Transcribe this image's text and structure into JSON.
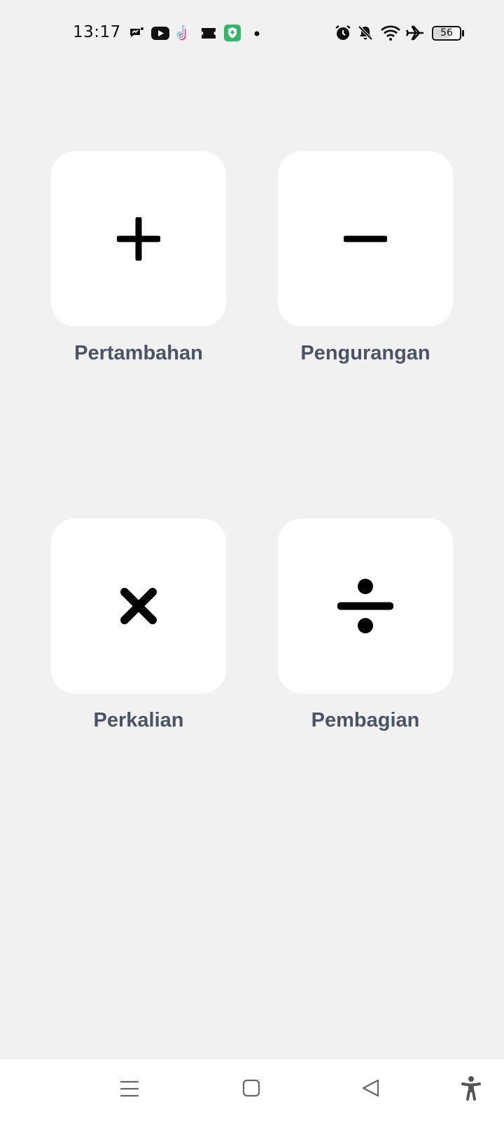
{
  "status_bar": {
    "time": "13:17",
    "battery": "56",
    "left_icons": [
      "messenger-icon",
      "youtube-icon",
      "tiktok-icon",
      "ticket-icon",
      "vpn-shield-icon",
      "dot-icon"
    ],
    "right_icons": [
      "alarm-icon",
      "bell-off-icon",
      "wifi-icon",
      "airplane-icon",
      "battery-icon"
    ]
  },
  "operations": [
    {
      "label": "Pertambahan",
      "icon": "plus-icon"
    },
    {
      "label": "Pengurangan",
      "icon": "minus-icon"
    },
    {
      "label": "Perkalian",
      "icon": "multiply-icon"
    },
    {
      "label": "Pembagian",
      "icon": "divide-icon"
    }
  ],
  "nav_bar": {
    "buttons": [
      "menu-icon",
      "home-icon",
      "back-icon",
      "accessibility-icon"
    ]
  },
  "colors": {
    "background": "#f1f1f1",
    "tile": "#ffffff",
    "label": "#4b5463",
    "icon": "#000000"
  }
}
